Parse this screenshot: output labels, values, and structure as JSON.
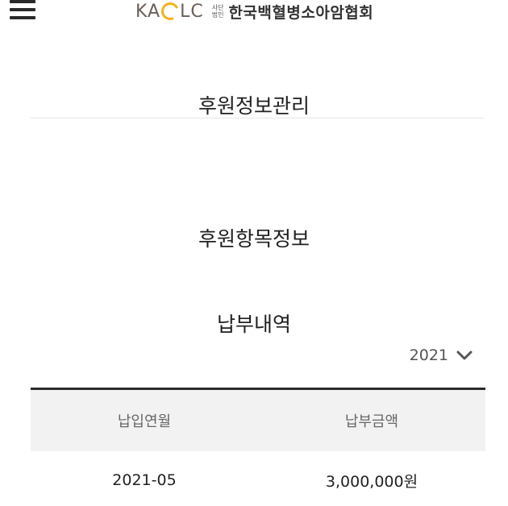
{
  "header": {
    "logo_mark": "KA",
    "logo_mark_end": "LC",
    "logo_sub_top": "사단",
    "logo_sub_bottom": "법인",
    "org_name": "한국백혈병소아암협회",
    "menu_icon": "hamburger-menu-icon"
  },
  "titles": {
    "manage": "후원정보관리",
    "items": "후원항목정보",
    "history": "납부내역"
  },
  "year_select": {
    "value": "2021",
    "icon": "chevron-down-icon"
  },
  "table": {
    "columns": [
      "납입연월",
      "납부금액"
    ],
    "rows": [
      {
        "month": "2021-05",
        "amount": "3,000,000원"
      }
    ]
  },
  "colors": {
    "logo_accent": "#f2b21a",
    "header_rule": "#2b2b2b",
    "table_head_bg": "#f2f2f2"
  }
}
